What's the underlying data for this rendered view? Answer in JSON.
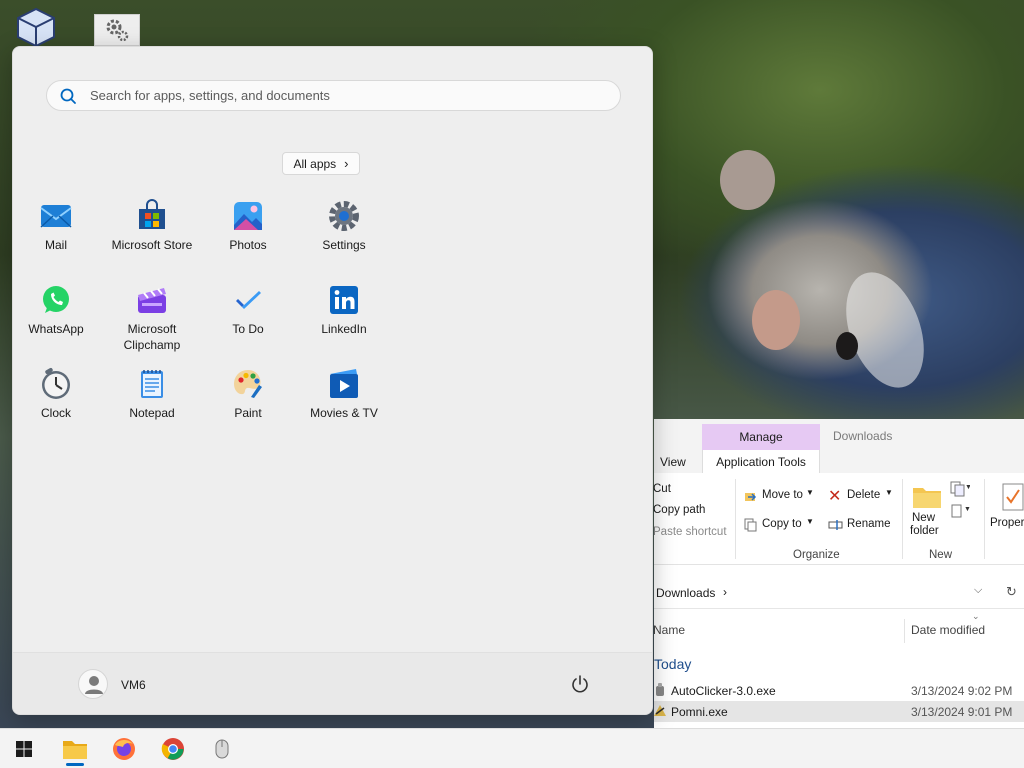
{
  "start_menu": {
    "search": {
      "placeholder": "Search for apps, settings, and documents"
    },
    "all_apps_label": "All apps",
    "pinned_apps": [
      {
        "label": "Mail",
        "icon": "mail-icon"
      },
      {
        "label": "Microsoft Store",
        "icon": "microsoft-store-icon"
      },
      {
        "label": "Photos",
        "icon": "photos-icon"
      },
      {
        "label": "Settings",
        "icon": "gear-icon"
      },
      {
        "label": "WhatsApp",
        "icon": "whatsapp-icon"
      },
      {
        "label": "Microsoft Clipchamp",
        "icon": "clipchamp-icon"
      },
      {
        "label": "To Do",
        "icon": "todo-check-icon"
      },
      {
        "label": "LinkedIn",
        "icon": "linkedin-icon"
      },
      {
        "label": "Clock",
        "icon": "clock-icon"
      },
      {
        "label": "Notepad",
        "icon": "notepad-icon"
      },
      {
        "label": "Paint",
        "icon": "paint-palette-icon"
      },
      {
        "label": "Movies & TV",
        "icon": "movies-tv-icon"
      }
    ],
    "user": {
      "name": "VM6"
    }
  },
  "explorer": {
    "title": "Downloads",
    "tabs": {
      "view": "View",
      "manage": "Manage",
      "application_tools": "Application Tools"
    },
    "ribbon": {
      "clipboard": {
        "cut": "Cut",
        "copy_path": "Copy path",
        "paste_shortcut": "Paste shortcut"
      },
      "organize": {
        "move_to": "Move to",
        "copy_to": "Copy to",
        "delete": "Delete",
        "rename": "Rename",
        "group_label": "Organize"
      },
      "new": {
        "new_folder_line1": "New",
        "new_folder_line2": "folder",
        "group_label": "New"
      },
      "open": {
        "properties": "Proper"
      }
    },
    "address": {
      "location": "Downloads"
    },
    "columns": {
      "name": "Name",
      "date_modified": "Date modified"
    },
    "group_today": "Today",
    "files": [
      {
        "name": "AutoClicker-3.0.exe",
        "date": "3/13/2024 9:02 PM",
        "selected": false
      },
      {
        "name": "Pomni.exe",
        "date": "3/13/2024 9:01 PM",
        "selected": true
      }
    ]
  },
  "colors": {
    "accent": "#0067c0",
    "manage_tab": "#e6c9f3",
    "start_bg": "#eeeeee"
  }
}
